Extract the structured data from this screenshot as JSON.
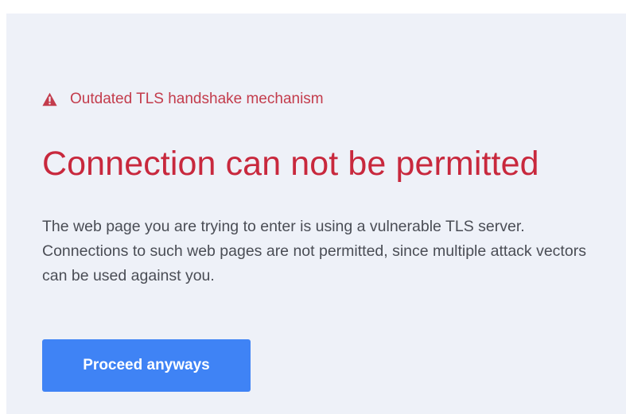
{
  "warning": {
    "icon": "warning-triangle-icon",
    "text": "Outdated TLS handshake mechanism",
    "color": "#c33c4c"
  },
  "error": {
    "title": "Connection can not be permitted",
    "title_color": "#c8283d",
    "description": "The web page you are trying to enter is using a vulnerable TLS server. Connections to such web pages are not permitted, since multiple attack vectors can be used against you."
  },
  "actions": {
    "proceed_label": "Proceed anyways",
    "proceed_color": "#3f83f5"
  },
  "theme": {
    "background": "#eef1f8",
    "text": "#4a4d55"
  }
}
